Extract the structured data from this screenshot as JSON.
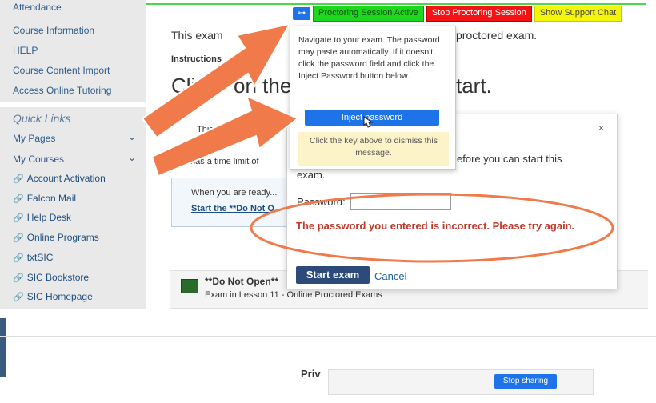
{
  "sidebar": {
    "items_top": [
      "Attendance",
      "Course Information",
      "HELP",
      "Course Content Import",
      "Access Online Tutoring"
    ],
    "quick_links_heading": "Quick Links",
    "my_pages": "My Pages",
    "my_courses": "My Courses",
    "links": [
      "Account Activation",
      "Falcon Mail",
      "Help Desk",
      "Online Programs",
      "txtSIC",
      "SIC Bookstore",
      "SIC Homepage"
    ]
  },
  "main": {
    "line1a": "This exam",
    "line1b": "proctored exam.",
    "instructions": "Instructions",
    "big_a": "Cli",
    "big_b": "on the",
    "big_c": "tart.",
    "this_exam": "This exa",
    "time_limit": "has a time limit of",
    "ready": "When you are ready...",
    "start_link": "Start the **Do Not O",
    "exam_title": "**Do Not Open**",
    "exam_sub": "Exam in Lesson 11 - Online Proctored Exams",
    "footer": "Priv"
  },
  "toolbar": {
    "active": "Proctoring Session Active",
    "stop": "Stop Proctoring Session",
    "chat": "Show Support Chat"
  },
  "popup": {
    "text": "Navigate to your exam. The password may paste automatically. If it doesn't, click the password field and click the Inject Password button below.",
    "inject": "Inject password",
    "dismiss": "Click the key above to dismiss this message."
  },
  "modal": {
    "line1": "efore you can start this",
    "line2": "exam.",
    "password_label": "Password:",
    "error": "The password you entered is incorrect. Please try again.",
    "start": "Start exam",
    "cancel": "Cancel",
    "close": "×"
  },
  "bottom": {
    "stop_sharing": "Stop sharing"
  },
  "colors": {
    "accent": "#1e73e8",
    "error": "#c0392b",
    "arrow": "#f07a4a"
  }
}
